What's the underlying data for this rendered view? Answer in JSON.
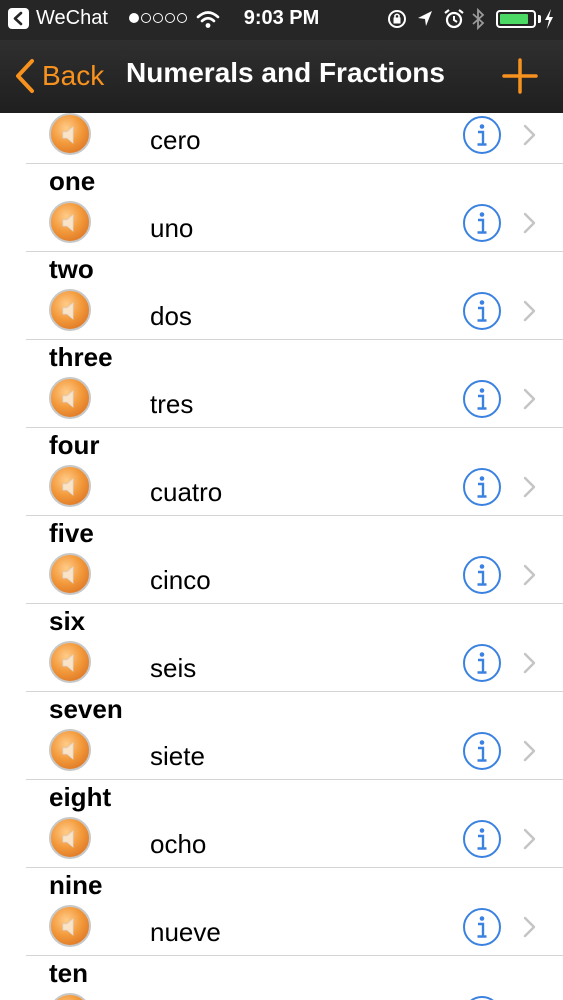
{
  "status_bar": {
    "app": "WeChat",
    "time": "9:03 PM",
    "signal_dots_filled": 1,
    "signal_dots_total": 5,
    "battery_level": 0.9,
    "battery_color": "#4cd964",
    "icons": [
      "back-to-app-icon",
      "wifi-icon",
      "rotation-lock-icon",
      "location-icon",
      "alarm-icon",
      "bluetooth-icon",
      "battery-icon",
      "charging-icon"
    ]
  },
  "nav": {
    "back_label": "Back",
    "title": "Numerals and Fractions",
    "accent_color": "#f7921e",
    "icons": [
      "chevron-left-icon",
      "plus-icon"
    ]
  },
  "list": {
    "row_icons": [
      "speaker-icon",
      "info-icon",
      "chevron-right-icon"
    ],
    "items": [
      {
        "english": "",
        "spanish": "cero"
      },
      {
        "english": "one",
        "spanish": "uno"
      },
      {
        "english": "two",
        "spanish": "dos"
      },
      {
        "english": "three",
        "spanish": "tres"
      },
      {
        "english": "four",
        "spanish": "cuatro"
      },
      {
        "english": "five",
        "spanish": "cinco"
      },
      {
        "english": "six",
        "spanish": "seis"
      },
      {
        "english": "seven",
        "spanish": "siete"
      },
      {
        "english": "eight",
        "spanish": "ocho"
      },
      {
        "english": "nine",
        "spanish": "nueve"
      },
      {
        "english": "ten",
        "spanish": ""
      }
    ]
  }
}
